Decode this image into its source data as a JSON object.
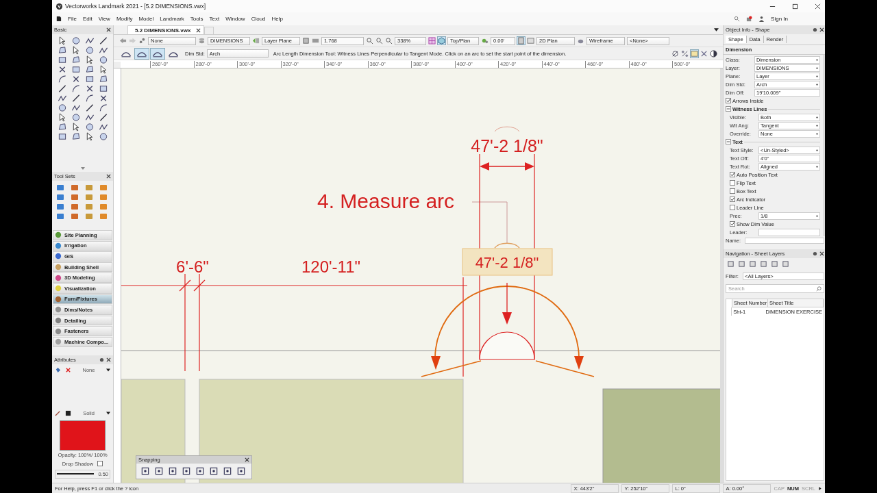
{
  "window": {
    "title": "Vectorworks Landmark 2021 - [5.2 DIMENSIONS.vwx]"
  },
  "menu": [
    "File",
    "Edit",
    "View",
    "Modify",
    "Model",
    "Landmark",
    "Tools",
    "Text",
    "Window",
    "Cloud",
    "Help"
  ],
  "account": {
    "sign_in": "Sign In"
  },
  "document_tab": {
    "label": "5.2 DIMENSIONS.vwx"
  },
  "view_bar": {
    "class": "None",
    "layer": "DIMENSIONS",
    "plane": "Layer Plane",
    "scale": "1.768",
    "zoom": "338%",
    "view": "Top/Plan",
    "rotation": "0.00'",
    "plane_mode": "2D Plan",
    "render": "Wireframe",
    "projection": "<None>"
  },
  "mode_bar": {
    "modes": [
      {
        "selected": false
      },
      {
        "selected": true
      },
      {
        "selected": true
      },
      {
        "selected": false
      }
    ],
    "dim_std_label": "Dim Std:",
    "dim_std": "Arch",
    "help": "Arc Length Dimension Tool: Witness Lines Perpendicular to Tangent Mode. Click on an arc to set the start point of the dimension."
  },
  "ruler": [
    "260'-0\"",
    "280'-0\"",
    "300'-0\"",
    "320'-0\"",
    "340'-0\"",
    "360'-0\"",
    "380'-0\"",
    "400'-0\"",
    "420'-0\"",
    "440'-0\"",
    "460'-0\"",
    "480'-0\"",
    "500'-0\""
  ],
  "canvas": {
    "heading": "4. Measure arc",
    "dim_top": "47'-2 1/8\"",
    "dim_preview": "47'-2 1/8\"",
    "dim_left": "6'-6\"",
    "dim_mid": "120'-11\""
  },
  "snapping": {
    "title": "Snapping"
  },
  "basic_palette": {
    "title": "Basic"
  },
  "tool_sets": {
    "title": "Tool Sets",
    "items": [
      {
        "label": "Site Planning",
        "selected": false
      },
      {
        "label": "Irrigation",
        "selected": false
      },
      {
        "label": "GIS",
        "selected": false
      },
      {
        "label": "Building Shell",
        "selected": false
      },
      {
        "label": "3D Modeling",
        "selected": false
      },
      {
        "label": "Visualization",
        "selected": false
      },
      {
        "label": "Furn/Fixtures",
        "selected": true
      },
      {
        "label": "Dims/Notes",
        "selected": false
      },
      {
        "label": "Detailing",
        "selected": false
      },
      {
        "label": "Fasteners",
        "selected": false
      },
      {
        "label": "Machine Compo...",
        "selected": false
      }
    ]
  },
  "attributes": {
    "title": "Attributes",
    "fill": "None",
    "pen": "Solid",
    "color": "#e0141a",
    "opacity": "Opacity: 100%/ 100%",
    "drop_shadow": "Drop Shadow",
    "drop_shadow_checked": false,
    "line_weight": "0.50"
  },
  "object_info": {
    "title": "Object Info - Shape",
    "tabs": [
      {
        "label": "Shape",
        "selected": true
      },
      {
        "label": "Data",
        "selected": false
      },
      {
        "label": "Render",
        "selected": false
      }
    ],
    "heading": "Dimension",
    "fields": [
      {
        "kind": "select",
        "label": "Class:",
        "value": "Dimension"
      },
      {
        "kind": "select",
        "label": "Layer:",
        "value": "DIMENSIONS"
      },
      {
        "kind": "select",
        "label": "Plane:",
        "value": "Layer"
      },
      {
        "kind": "select",
        "label": "Dim Std:",
        "value": "Arch"
      },
      {
        "kind": "text",
        "label": "Dim Off:",
        "value": "19'10.009\""
      },
      {
        "kind": "checkbox",
        "label": "Arrows Inside",
        "checked": true
      },
      {
        "kind": "section",
        "label": "Witness Lines",
        "expanded": true,
        "children": [
          {
            "kind": "select",
            "label": "Visible:",
            "value": "Both"
          },
          {
            "kind": "select",
            "label": "Wit Ang:",
            "value": "Tangent"
          },
          {
            "kind": "select",
            "label": "Override:",
            "value": "None"
          }
        ]
      },
      {
        "kind": "section",
        "label": "Text",
        "expanded": true,
        "children": [
          {
            "kind": "select",
            "label": "Text Style:",
            "value": "<Un-Styled>"
          },
          {
            "kind": "text",
            "label": "Text Off:",
            "value": "4'0\""
          },
          {
            "kind": "select",
            "label": "Text Rot:",
            "value": "Aligned"
          },
          {
            "kind": "checkbox",
            "label": "Auto Position Text",
            "checked": true
          },
          {
            "kind": "checkbox",
            "label": "Flip Text",
            "checked": false
          },
          {
            "kind": "checkbox",
            "label": "Box Text",
            "checked": false
          },
          {
            "kind": "checkbox",
            "label": "Arc Indicator",
            "checked": true
          },
          {
            "kind": "checkbox",
            "label": "Leader Line",
            "checked": false
          },
          {
            "kind": "select",
            "label": "Prec:",
            "value": "1/8"
          },
          {
            "kind": "checkbox",
            "label": "Show Dim Value",
            "checked": true
          },
          {
            "kind": "text",
            "label": "Leader:"
          }
        ]
      }
    ],
    "name_label": "Name:"
  },
  "navigation": {
    "title": "Navigation - Sheet Layers",
    "filter_label": "Filter:",
    "filter": "<All Layers>",
    "search_placeholder": "Search",
    "columns": [
      "Sheet Number",
      "Sheet Title"
    ],
    "rows": [
      [
        "Sht-1",
        "DIMENSION EXERCISE"
      ]
    ]
  },
  "status_bar": {
    "help": "For Help, press F1 or click the ? icon",
    "x": "X: 443'2\"",
    "y": "Y: 252'10\"",
    "l": "L: 0\"",
    "a": "A: 0.00°",
    "keys": [
      {
        "label": "CAP",
        "on": false
      },
      {
        "label": "NUM",
        "on": true
      },
      {
        "label": "SCRL",
        "on": false
      }
    ]
  }
}
